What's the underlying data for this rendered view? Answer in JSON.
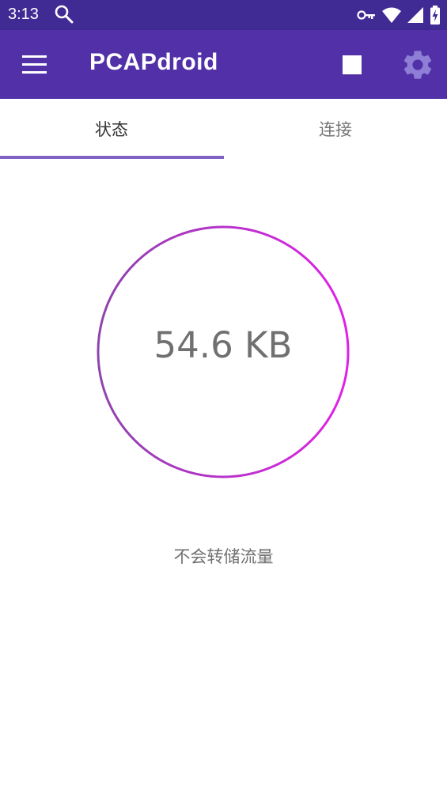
{
  "status_bar": {
    "time": "3:13",
    "icons": [
      "search-icon",
      "vpn-key-icon",
      "wifi-icon",
      "signal-icon",
      "battery-charging-icon"
    ]
  },
  "app_bar": {
    "title": "PCAPdroid",
    "menu_icon": "hamburger-menu-icon",
    "stop_icon": "stop-icon",
    "settings_icon": "gear-icon"
  },
  "tabs": [
    {
      "label": "状态",
      "selected": true
    },
    {
      "label": "连接",
      "selected": false
    }
  ],
  "main": {
    "traffic_total": "54.6 KB",
    "dump_status": "不会转储流量"
  },
  "colors": {
    "status_bar": "#402a94",
    "app_bar": "#5231a8",
    "tab_indicator": "#7e62c4",
    "gauge_gradient_start": "#8e44ad",
    "gauge_gradient_end": "#e020e8"
  }
}
